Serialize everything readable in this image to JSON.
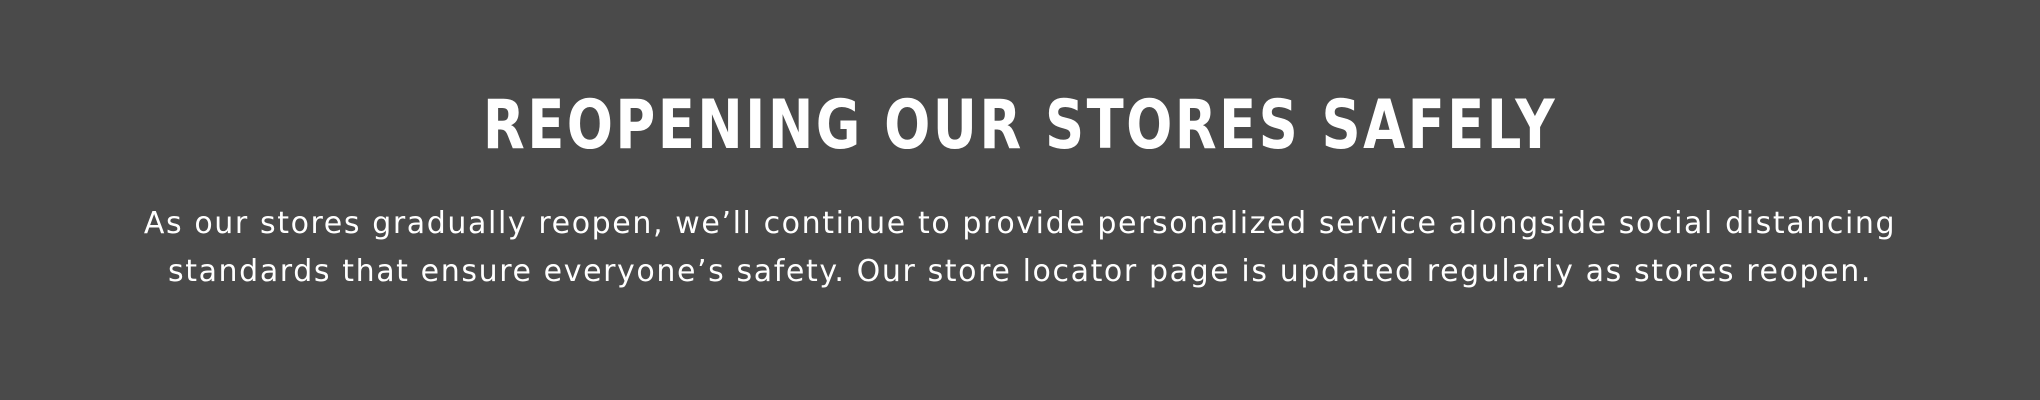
{
  "banner": {
    "heading": "REOPENING OUR STORES SAFELY",
    "body_lines": [
      "As our stores gradually reopen, we’ll continue to provide personalized service alongside social distancing",
      "standards that ensure everyone’s safety. Our store locator page is updated regularly as stores reopen."
    ],
    "colors": {
      "background": "#4a4a4a",
      "text": "#ffffff"
    }
  }
}
